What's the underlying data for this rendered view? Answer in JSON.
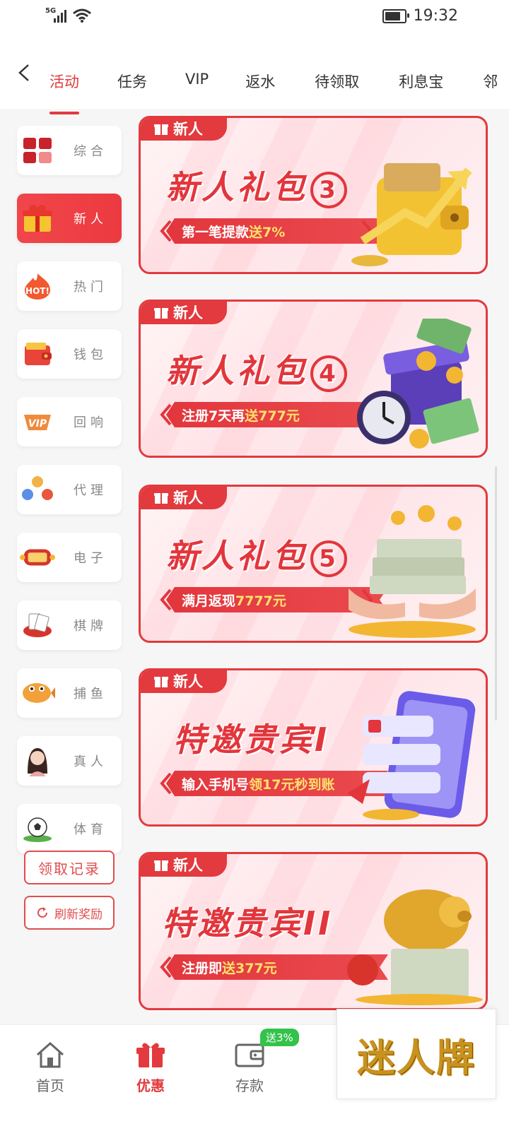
{
  "status_bar": {
    "network": "5G",
    "time": "19:32"
  },
  "top_tabs": [
    "活动",
    "任务",
    "VIP",
    "返水",
    "待领取",
    "利息宝",
    "邻"
  ],
  "sidebar": {
    "items": [
      {
        "label": "综合",
        "icon": "grid-icon"
      },
      {
        "label": "新人",
        "icon": "gift-box-icon",
        "active": true
      },
      {
        "label": "热门",
        "icon": "hot-badge-icon"
      },
      {
        "label": "钱包",
        "icon": "wallet-icon"
      },
      {
        "label": "回响",
        "icon": "vip-badge-icon"
      },
      {
        "label": "代理",
        "icon": "agents-icon"
      },
      {
        "label": "电子",
        "icon": "slot-machine-icon"
      },
      {
        "label": "棋牌",
        "icon": "poker-chip-icon"
      },
      {
        "label": "捕鱼",
        "icon": "fish-icon"
      },
      {
        "label": "真人",
        "icon": "dealer-avatar-icon"
      },
      {
        "label": "体育",
        "icon": "soccer-ball-icon"
      }
    ],
    "records_button": "领取记录",
    "refresh_button": "刷新奖励"
  },
  "banners": [
    {
      "tag": "新人",
      "title": "新人礼包",
      "num": "3",
      "sub_pre": "第一笔提款",
      "sub_hl": "送7%",
      "art": "gold-wallet-art"
    },
    {
      "tag": "新人",
      "title": "新人礼包",
      "num": "4",
      "sub_pre": "注册7天再",
      "sub_hl": "送777元",
      "art": "money-box-clock-art"
    },
    {
      "tag": "新人",
      "title": "新人礼包",
      "num": "5",
      "sub_pre": "满月返现",
      "sub_hl": "7777元",
      "art": "cash-hands-art"
    },
    {
      "tag": "新人",
      "title": "特邀贵宾I",
      "num": "",
      "sub_pre": "输入手机号",
      "sub_hl": "领17元秒到账",
      "art": "phone-art"
    },
    {
      "tag": "新人",
      "title": "特邀贵宾II",
      "num": "",
      "sub_pre": "注册即",
      "sub_hl": "送377元",
      "art": "golden-pig-art"
    }
  ],
  "bottom_nav": {
    "items": [
      {
        "label": "首页",
        "icon": "home-icon"
      },
      {
        "label": "优惠",
        "icon": "gift-icon",
        "active": true
      },
      {
        "label": "存款",
        "icon": "deposit-wallet-icon"
      }
    ],
    "deposit_badge": "送3%"
  },
  "brand_overlay": "迷人牌",
  "colors": {
    "accent": "#e23a3e",
    "highlight": "#ffe16b",
    "badge": "#33c24a"
  }
}
